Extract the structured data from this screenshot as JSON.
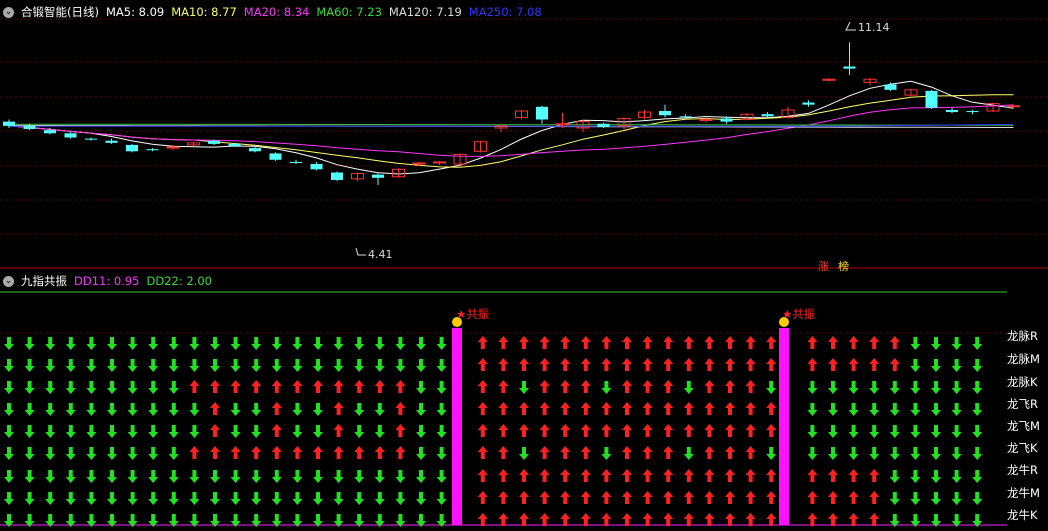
{
  "header": {
    "stock_name": "合锻智能(日线)",
    "ma": [
      {
        "label": "MA5: 8.09",
        "color": "#ffffff"
      },
      {
        "label": "MA10: 8.77",
        "color": "#ffff66"
      },
      {
        "label": "MA20: 8.34",
        "color": "#ff33ff"
      },
      {
        "label": "MA60: 7.23",
        "color": "#33cc33"
      },
      {
        "label": "MA120: 7.19",
        "color": "#dddddd"
      },
      {
        "label": "MA250: 7.08",
        "color": "#3333ff"
      }
    ]
  },
  "price_labels": {
    "high": "11.14",
    "low": "4.41"
  },
  "tags": [
    "涨",
    "榜"
  ],
  "indicator": {
    "title": "九指共振",
    "dd11": "DD11: 0.95",
    "dd22": "DD22: 2.00",
    "resonance_label": "共振",
    "rows": [
      "龙脉R",
      "龙脉M",
      "龙脉K",
      "龙飞R",
      "龙飞M",
      "龙飞K",
      "龙牛R",
      "龙牛M",
      "龙牛K"
    ]
  },
  "colors": {
    "up": "#ff3030",
    "down": "#54ffff",
    "magenta": "#ff20ff",
    "arrow_up": "#ff2020",
    "arrow_down": "#22e022"
  },
  "chart_data": {
    "type": "candlestick",
    "candles": [
      [
        7.4,
        7.5,
        7.1,
        7.2
      ],
      [
        7.2,
        7.3,
        7.0,
        7.05
      ],
      [
        7.0,
        7.1,
        6.8,
        6.85
      ],
      [
        6.85,
        6.9,
        6.6,
        6.65
      ],
      [
        6.6,
        6.65,
        6.5,
        6.55
      ],
      [
        6.5,
        6.6,
        6.35,
        6.4
      ],
      [
        6.3,
        6.35,
        5.95,
        6.0
      ],
      [
        6.1,
        6.15,
        6.0,
        6.05
      ],
      [
        6.2,
        6.3,
        6.05,
        6.2
      ],
      [
        6.3,
        6.45,
        6.25,
        6.4
      ],
      [
        6.5,
        6.55,
        6.3,
        6.35
      ],
      [
        6.35,
        6.4,
        6.2,
        6.25
      ],
      [
        6.15,
        6.2,
        5.95,
        6.0
      ],
      [
        5.9,
        5.95,
        5.55,
        5.6
      ],
      [
        5.5,
        5.6,
        5.4,
        5.45
      ],
      [
        5.4,
        5.5,
        5.1,
        5.15
      ],
      [
        5.0,
        5.05,
        4.6,
        4.65
      ],
      [
        4.7,
        5.0,
        4.6,
        4.95
      ],
      [
        4.9,
        4.95,
        4.41,
        4.75
      ],
      [
        4.8,
        5.2,
        4.75,
        5.15
      ],
      [
        5.4,
        5.5,
        5.3,
        5.45
      ],
      [
        5.45,
        5.55,
        5.35,
        5.5
      ],
      [
        5.4,
        5.9,
        5.35,
        5.85
      ],
      [
        6.0,
        6.5,
        5.95,
        6.45
      ],
      [
        7.1,
        7.2,
        6.9,
        7.2
      ],
      [
        7.6,
        7.95,
        7.5,
        7.9
      ],
      [
        8.1,
        8.15,
        7.3,
        7.5
      ],
      [
        7.3,
        7.8,
        7.1,
        7.3
      ],
      [
        7.1,
        7.5,
        6.9,
        7.4
      ],
      [
        7.3,
        7.35,
        7.1,
        7.15
      ],
      [
        7.2,
        7.6,
        7.0,
        7.55
      ],
      [
        7.6,
        7.95,
        7.5,
        7.85
      ],
      [
        7.9,
        8.2,
        7.6,
        7.7
      ],
      [
        7.65,
        7.75,
        7.55,
        7.6
      ],
      [
        7.5,
        7.6,
        7.35,
        7.5
      ],
      [
        7.55,
        7.65,
        7.3,
        7.4
      ],
      [
        7.5,
        7.8,
        7.45,
        7.75
      ],
      [
        7.75,
        7.85,
        7.6,
        7.65
      ],
      [
        7.6,
        8.1,
        7.55,
        7.95
      ],
      [
        8.3,
        8.4,
        8.1,
        8.2
      ],
      [
        9.35,
        9.45,
        9.3,
        9.4
      ],
      [
        10.0,
        11.14,
        9.6,
        9.9
      ],
      [
        9.25,
        9.45,
        9.1,
        9.4
      ],
      [
        9.15,
        9.25,
        8.85,
        8.9
      ],
      [
        8.65,
        8.95,
        8.6,
        8.9
      ],
      [
        8.85,
        8.9,
        8.0,
        8.05
      ],
      [
        7.95,
        8.05,
        7.8,
        7.85
      ],
      [
        7.9,
        7.95,
        7.75,
        7.85
      ],
      [
        7.9,
        8.3,
        7.85,
        8.25
      ],
      [
        8.1,
        8.2,
        8.0,
        8.15
      ]
    ]
  }
}
